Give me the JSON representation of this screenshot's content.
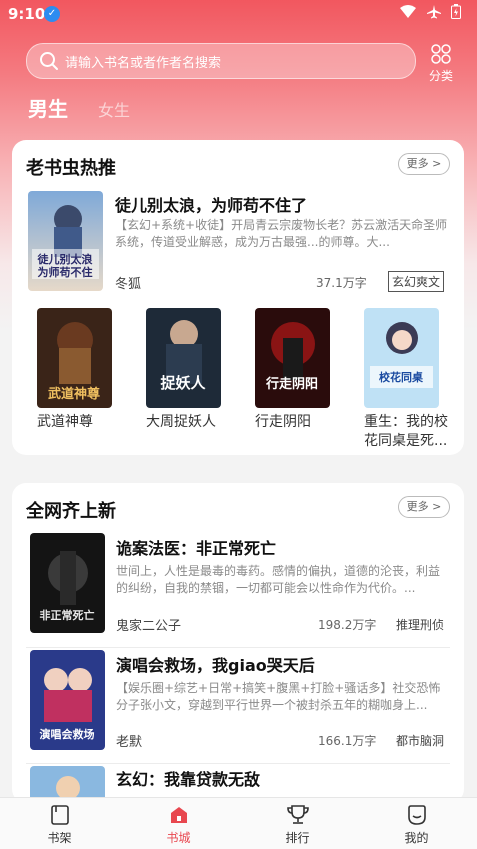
{
  "status_bar": {
    "time": "9:10",
    "badge": "✓"
  },
  "search": {
    "placeholder": "请输入书名或者作者名搜索"
  },
  "category_label": "分类",
  "gender_tabs": {
    "male": "男生",
    "female": "女生"
  },
  "section_hot": {
    "title": "老书虫热推",
    "more": "更多 >",
    "featured": {
      "title": "徒儿别太浪，为师苟不住了",
      "desc": "【玄幻+系统+收徒】开局青云宗废物长老？苏云激活天命圣师系统，传道受业解惑，成为万古最强...的师尊。大...",
      "author": "冬狐",
      "words": "37.1万字",
      "tag": "玄幻爽文",
      "cover_text": "徒儿别太浪为师苟不住了"
    },
    "grid": [
      {
        "name": "武道神尊",
        "cover_text": "武道神尊"
      },
      {
        "name": "大周捉妖人",
        "cover_text": "捉妖人"
      },
      {
        "name": "行走阴阳",
        "cover_text": "行走阴阳"
      },
      {
        "name": "重生：我的校花同桌是死...",
        "cover_text": "校花同桌"
      }
    ]
  },
  "section_new": {
    "title": "全网齐上新",
    "more": "更多 >",
    "books": [
      {
        "title": "诡案法医：非正常死亡",
        "desc": "世间上，人性是最毒的毒药。感情的偏执，道德的沦丧，利益的纠纷，自我的禁锢，一切都可能会以性命作为代价。...",
        "author": "鬼家二公子",
        "words": "198.2万字",
        "tag": "推理刑侦",
        "cover_text": "非正常死亡"
      },
      {
        "title": "演唱会救场，我giao哭天后",
        "desc": "【娱乐圈+综艺+日常+搞笑+腹黑+打脸+骚话多】社交恐怖分子张小文，穿越到平行世界一个被封杀五年的糊咖身上...",
        "author": "老默",
        "words": "166.1万字",
        "tag": "都市脑洞",
        "cover_text": "演唱会救场"
      },
      {
        "title": "玄幻：我靠贷款无敌"
      }
    ]
  },
  "tab_bar": [
    {
      "label": "书架",
      "icon": "bookshelf-icon"
    },
    {
      "label": "书城",
      "icon": "bookstore-icon",
      "active": true
    },
    {
      "label": "排行",
      "icon": "trophy-icon"
    },
    {
      "label": "我的",
      "icon": "profile-icon"
    }
  ],
  "colors": {
    "accent": "#e8474f",
    "header_top": "#f2575f"
  }
}
